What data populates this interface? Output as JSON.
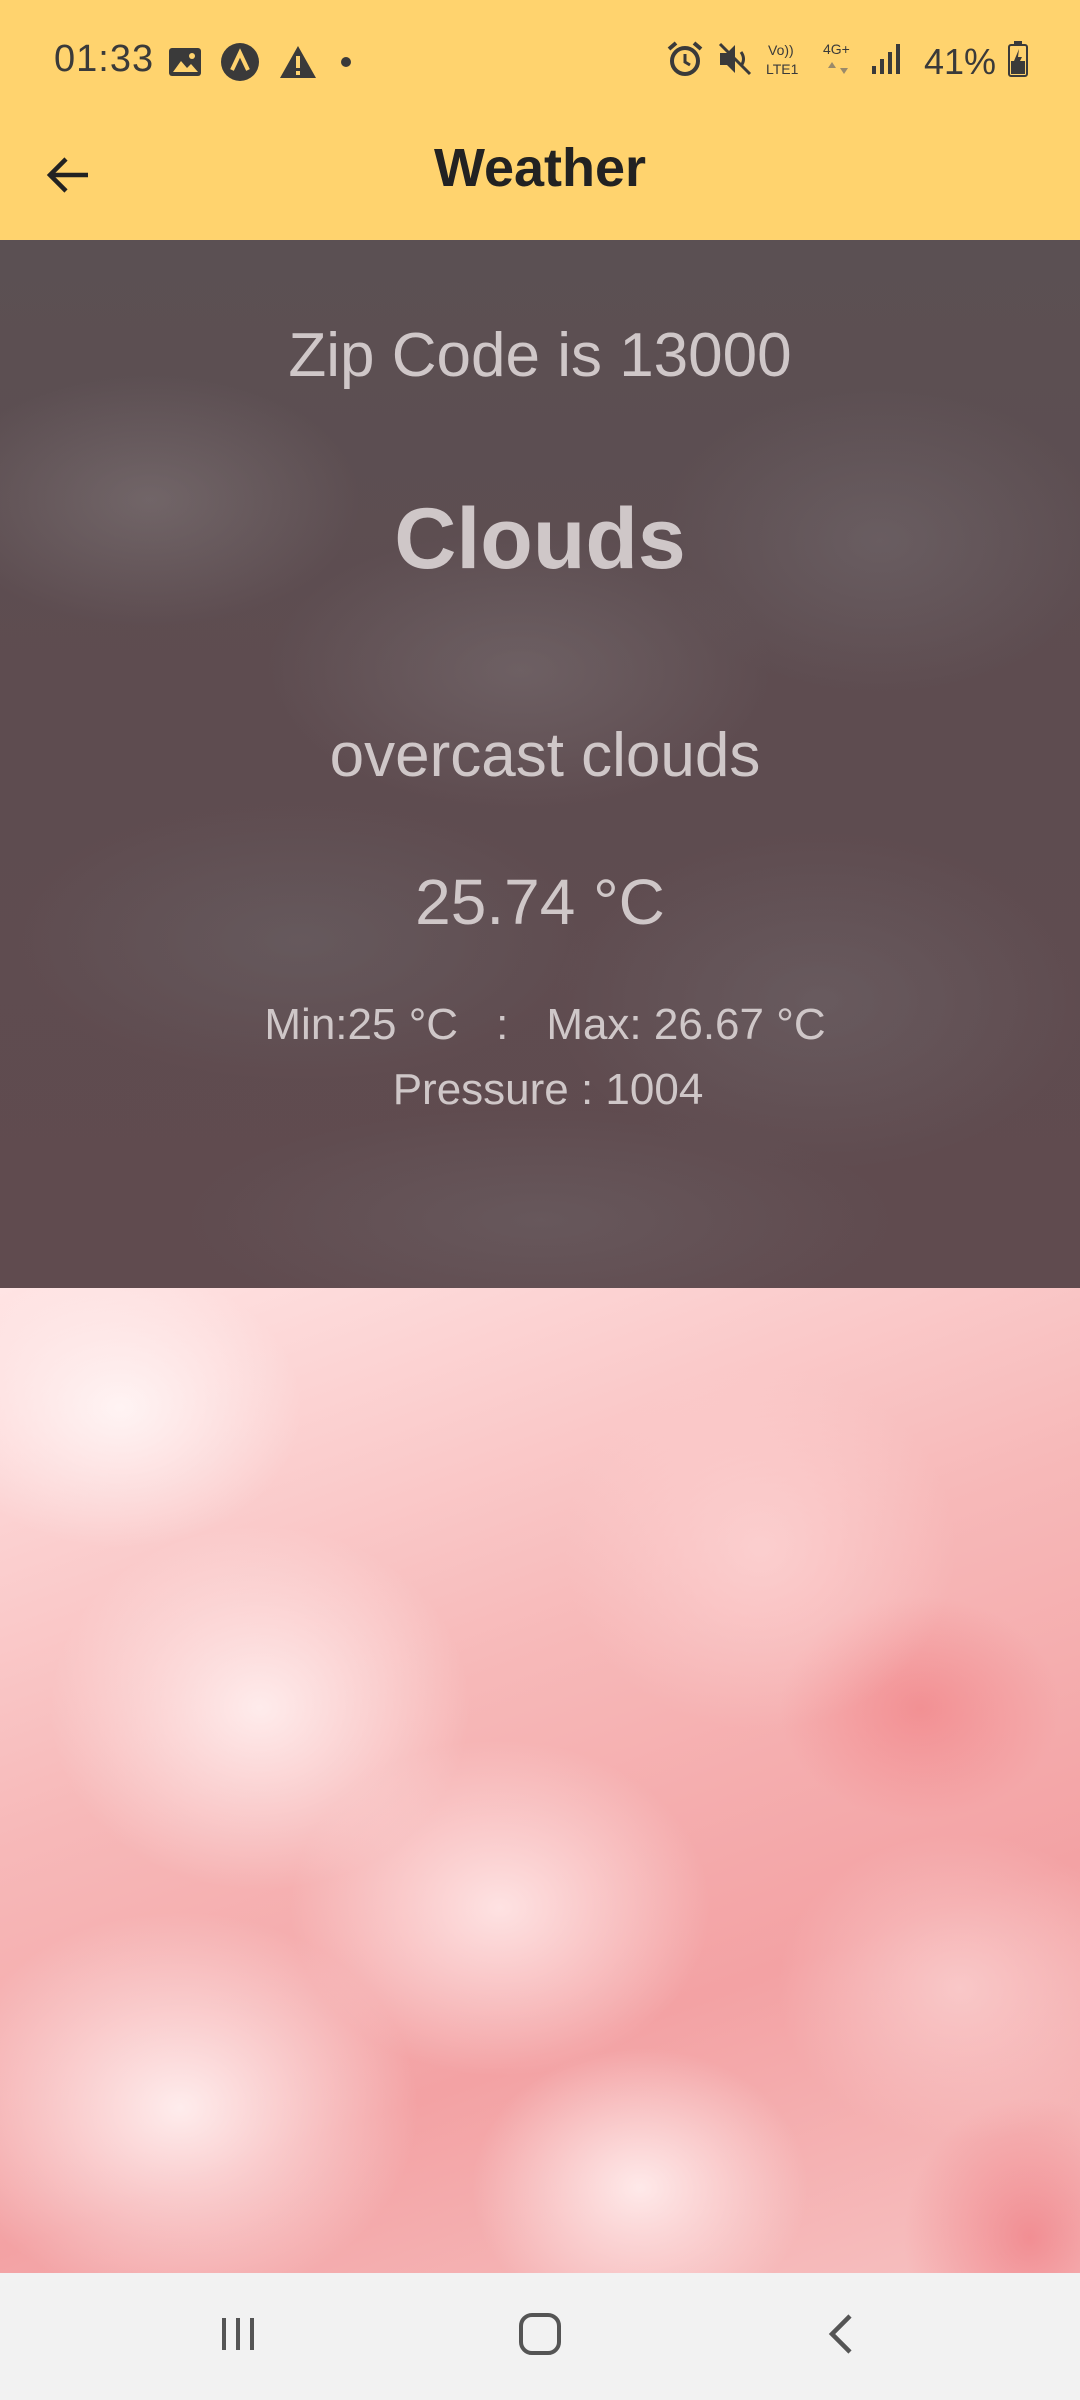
{
  "status_bar": {
    "time": "01:33",
    "left_icons": [
      "gallery-icon",
      "a-circle-icon",
      "warning-icon",
      "dot-icon"
    ],
    "right_icons": [
      "alarm-icon",
      "mute-icon",
      "volte-icon",
      "4g-icon",
      "signal-icon"
    ],
    "network_text": "Vo)) LTE1",
    "network_type": "4G+",
    "battery": "41%"
  },
  "app_bar": {
    "title": "Weather",
    "back_icon": "arrow-back-icon",
    "background": "#ffd36e"
  },
  "weather": {
    "zip_text": "Zip Code is 13000",
    "condition": "Clouds",
    "description": "overcast clouds",
    "temperature": "25.74 °C",
    "min": "Min:25 °C",
    "separator": ":",
    "max": "Max: 26.67 °C",
    "pressure": "Pressure : 1004"
  },
  "nav_bar": {
    "recents_icon": "recents-icon",
    "home_icon": "home-icon",
    "back_icon": "back-chevron-icon"
  }
}
